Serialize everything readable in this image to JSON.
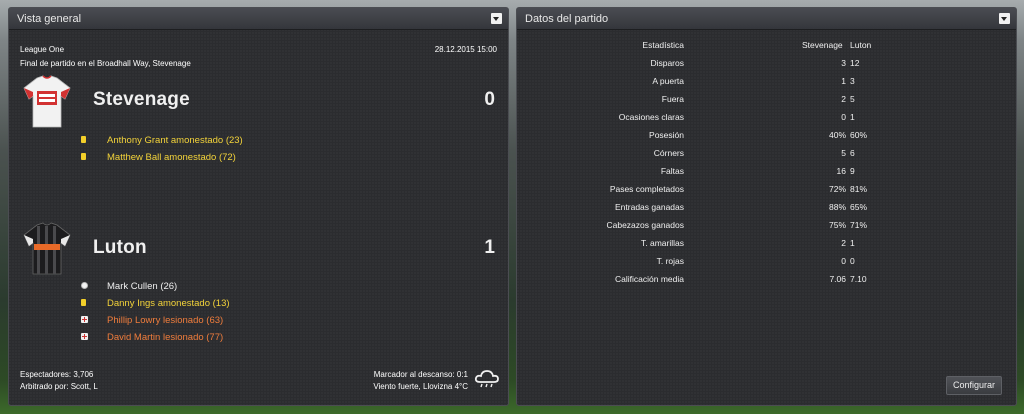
{
  "overview": {
    "title": "Vista general",
    "competition": "League One",
    "datetime": "28.12.2015 15:00",
    "venue_line": "Final de partido en el Broadhall Way, Stevenage",
    "home": {
      "name": "Stevenage",
      "score": "0",
      "kit": "red-white-shirt-icon",
      "events": [
        {
          "type": "yellow-card",
          "text": "Anthony Grant amonestado (23)"
        },
        {
          "type": "yellow-card",
          "text": "Matthew Ball amonestado (72)"
        }
      ]
    },
    "away": {
      "name": "Luton",
      "score": "1",
      "kit": "black-striped-shirt-icon",
      "events": [
        {
          "type": "goal",
          "text": "Mark Cullen (26)"
        },
        {
          "type": "yellow-card",
          "text": "Danny Ings amonestado (13)"
        },
        {
          "type": "injury",
          "text": "Phillip Lowry lesionado (63)"
        },
        {
          "type": "injury",
          "text": "David Martin lesionado (77)"
        }
      ]
    },
    "attendance": "Espectadores: 3,706",
    "referee": "Arbitrado por: Scott, L",
    "halftime": "Marcador al descanso: 0:1",
    "weather": "Viento fuerte, Llovizna 4°C",
    "weather_icon": "rain-cloud-icon"
  },
  "stats": {
    "title": "Datos del partido",
    "header": {
      "label": "Estadística",
      "home": "Stevenage",
      "away": "Luton"
    },
    "rows": [
      {
        "label": "Disparos",
        "home": "3",
        "away": "12"
      },
      {
        "label": "A puerta",
        "home": "1",
        "away": "3"
      },
      {
        "label": "Fuera",
        "home": "2",
        "away": "5"
      },
      {
        "label": "Ocasiones claras",
        "home": "0",
        "away": "1"
      },
      {
        "label": "Posesión",
        "home": "40%",
        "away": "60%"
      },
      {
        "label": "Córners",
        "home": "5",
        "away": "6"
      },
      {
        "label": "Faltas",
        "home": "16",
        "away": "9"
      },
      {
        "label": "Pases completados",
        "home": "72%",
        "away": "81%"
      },
      {
        "label": "Entradas ganadas",
        "home": "88%",
        "away": "65%"
      },
      {
        "label": "Cabezazos ganados",
        "home": "75%",
        "away": "71%"
      },
      {
        "label": "T. amarillas",
        "home": "2",
        "away": "1"
      },
      {
        "label": "T. rojas",
        "home": "0",
        "away": "0"
      },
      {
        "label": "Calificación media",
        "home": "7.06",
        "away": "7.10"
      }
    ],
    "configure_label": "Configurar"
  },
  "colors": {
    "yellow_event": "#f3d33a",
    "injury_event": "#f07d3c",
    "panel_bg": "#2b2c2f"
  }
}
